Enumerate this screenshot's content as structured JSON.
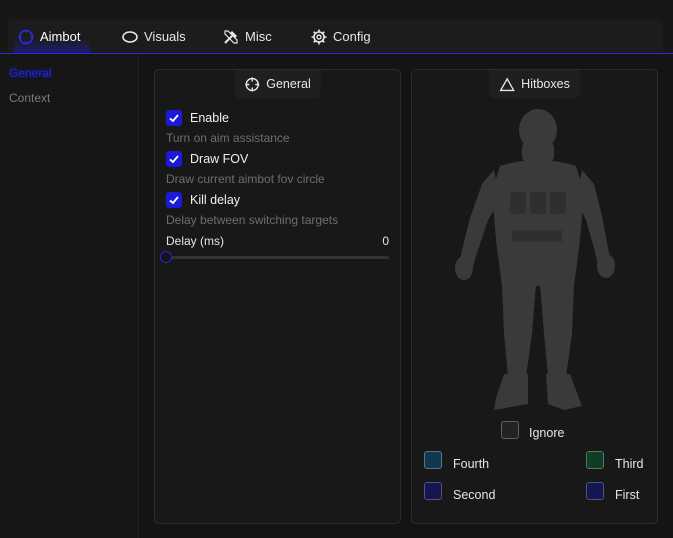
{
  "tabs": [
    {
      "label": "Aimbot",
      "icon": "target-icon",
      "active": true
    },
    {
      "label": "Visuals",
      "icon": "eye-icon",
      "active": false
    },
    {
      "label": "Misc",
      "icon": "tools-icon",
      "active": false
    },
    {
      "label": "Config",
      "icon": "gear-icon",
      "active": false
    }
  ],
  "sidebar": {
    "items": [
      {
        "label": "General",
        "active": true
      },
      {
        "label": "Context",
        "active": false
      }
    ]
  },
  "general": {
    "title": "General",
    "icon": "crosshair-icon",
    "options": [
      {
        "label": "Enable",
        "description": "Turn on aim assistance",
        "checked": true
      },
      {
        "label": "Draw FOV",
        "description": "Draw current aimbot fov circle",
        "checked": true
      },
      {
        "label": "Kill delay",
        "description": "Delay between switching targets",
        "checked": true
      }
    ],
    "slider": {
      "label": "Delay (ms)",
      "value": "0",
      "fraction": 0
    }
  },
  "hitboxes": {
    "title": "Hitboxes",
    "icon": "triangle-icon",
    "ignore": {
      "label": "Ignore",
      "color": "#232323"
    },
    "priorities": [
      {
        "label": "Fourth",
        "color": "#11384f"
      },
      {
        "label": "Third",
        "color": "#103d24"
      },
      {
        "label": "Second",
        "color": "#16164f"
      },
      {
        "label": "First",
        "color": "#16164f"
      }
    ]
  },
  "colors": {
    "accent": "#2222dd",
    "background": "#141414"
  }
}
